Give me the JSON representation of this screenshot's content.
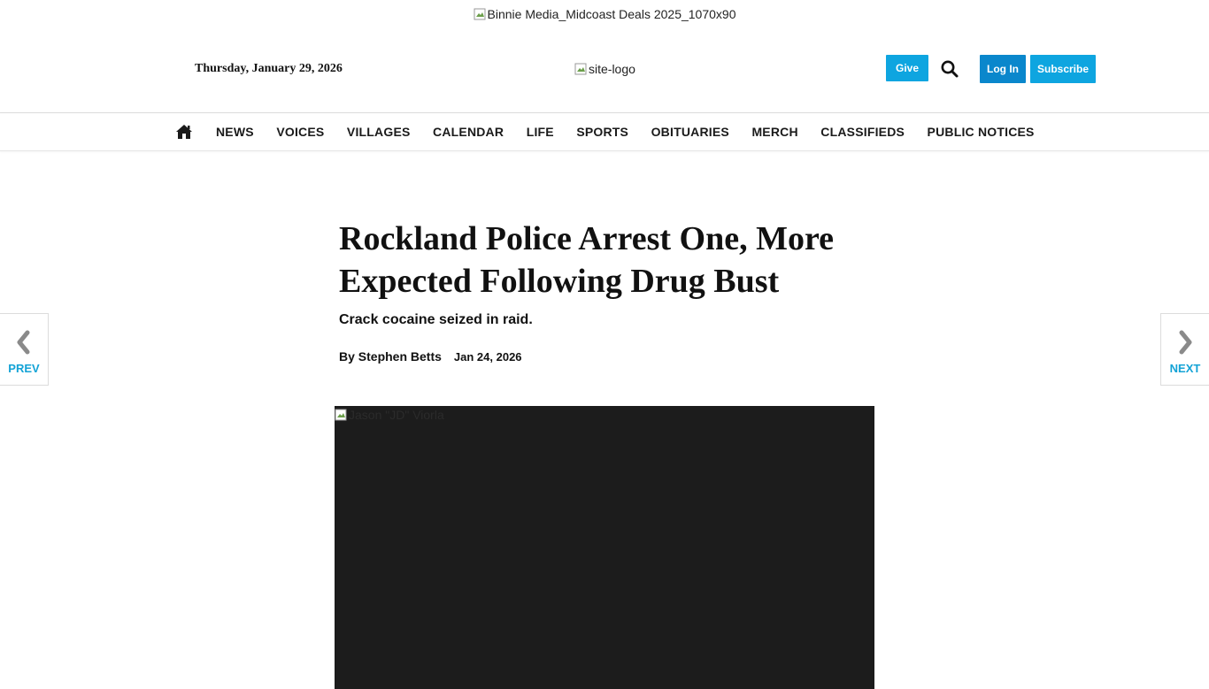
{
  "ad": {
    "alt": "Binnie Media_Midcoast Deals 2025_1070x90"
  },
  "header": {
    "date": "Thursday, January 29, 2026",
    "logo_alt": "site-logo",
    "give_label": "Give",
    "login_label": "Log In",
    "subscribe_label": "Subscribe",
    "search_icon": "search-icon",
    "accent_color": "#0ea5e0"
  },
  "nav": {
    "home_icon": "home-icon",
    "items": [
      {
        "label": "NEWS"
      },
      {
        "label": "VOICES"
      },
      {
        "label": "VILLAGES"
      },
      {
        "label": "CALENDAR"
      },
      {
        "label": "LIFE"
      },
      {
        "label": "SPORTS"
      },
      {
        "label": "OBITUARIES"
      },
      {
        "label": "MERCH"
      },
      {
        "label": "CLASSIFIEDS"
      },
      {
        "label": "PUBLIC NOTICES"
      }
    ]
  },
  "article": {
    "headline": "Rockland Police Arrest One, More Expected Following Drug Bust",
    "subhead": "Crack cocaine seized in raid.",
    "author": "By Stephen Betts",
    "date": "Jan 24, 2026",
    "image_alt": "Jason \"JD\" Viorla"
  },
  "pager": {
    "prev_label": "PREV",
    "next_label": "NEXT",
    "label_color": "#14a3d6"
  }
}
